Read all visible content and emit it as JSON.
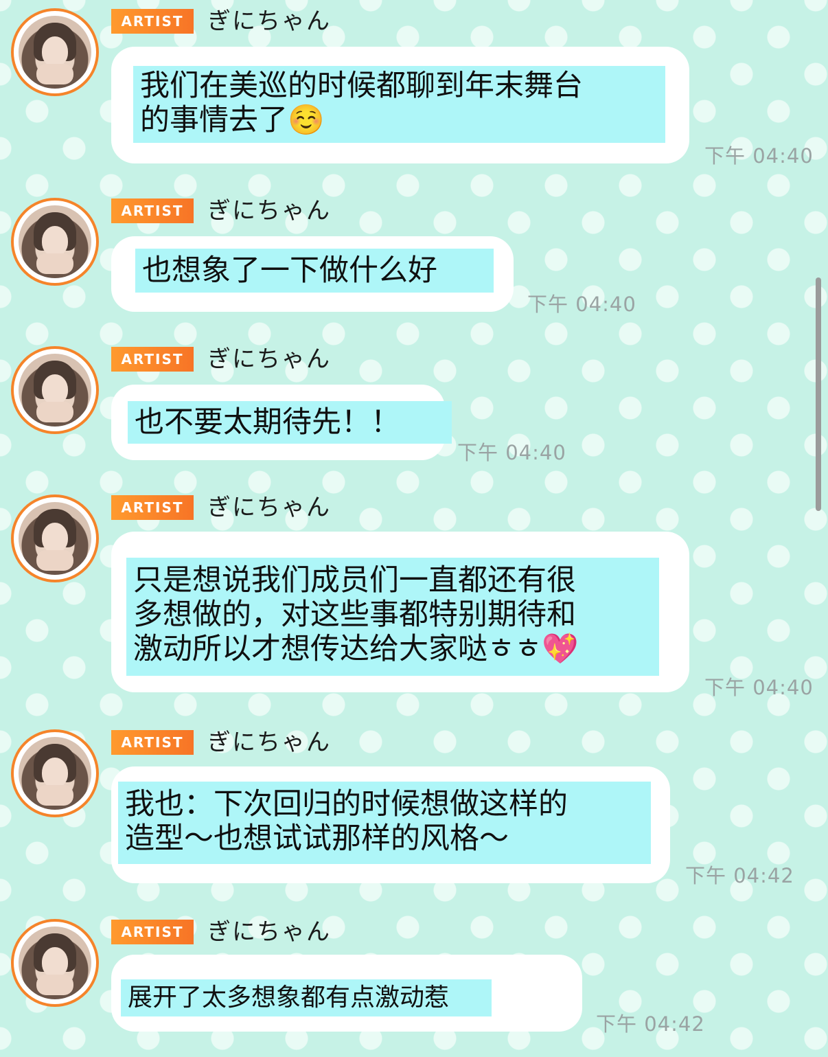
{
  "chat": {
    "messages": [
      {
        "badge": "ARTIST",
        "sender": "ぎにちゃん",
        "text": "我们在美巡的时候都聊到年末舞台\n的事情去了☺️",
        "time": "下午 04:40"
      },
      {
        "badge": "ARTIST",
        "sender": "ぎにちゃん",
        "text": "也想象了一下做什么好",
        "time": "下午 04:40"
      },
      {
        "badge": "ARTIST",
        "sender": "ぎにちゃん",
        "text": "也不要太期待先！！",
        "time": "下午 04:40"
      },
      {
        "badge": "ARTIST",
        "sender": "ぎにちゃん",
        "text": "只是想说我们成员们一直都还有很\n多想做的，对这些事都特别期待和\n激动所以才想传达给大家哒ㅎㅎ💖",
        "time": "下午 04:40"
      },
      {
        "badge": "ARTIST",
        "sender": "ぎにちゃん",
        "text": "我也：下次回归的时候想做这样的\n造型～也想试试那样的风格～",
        "time": "下午 04:42"
      },
      {
        "badge": "ARTIST",
        "sender": "ぎにちゃん",
        "text": "展开了太多想象都有点激动惹·.¸¸♬",
        "time": "下午 04:42"
      }
    ]
  },
  "colors": {
    "background": "#c6f2e6",
    "polka_dot": "#e9fbf5",
    "badge_orange": "#f77426",
    "avatar_ring": "#f5842a",
    "highlight": "#aef6f8",
    "bubble": "#ffffff",
    "timestamp": "#9aa3a3"
  },
  "icons": {
    "avatar": "profile-photo",
    "badge": "artist-badge"
  }
}
